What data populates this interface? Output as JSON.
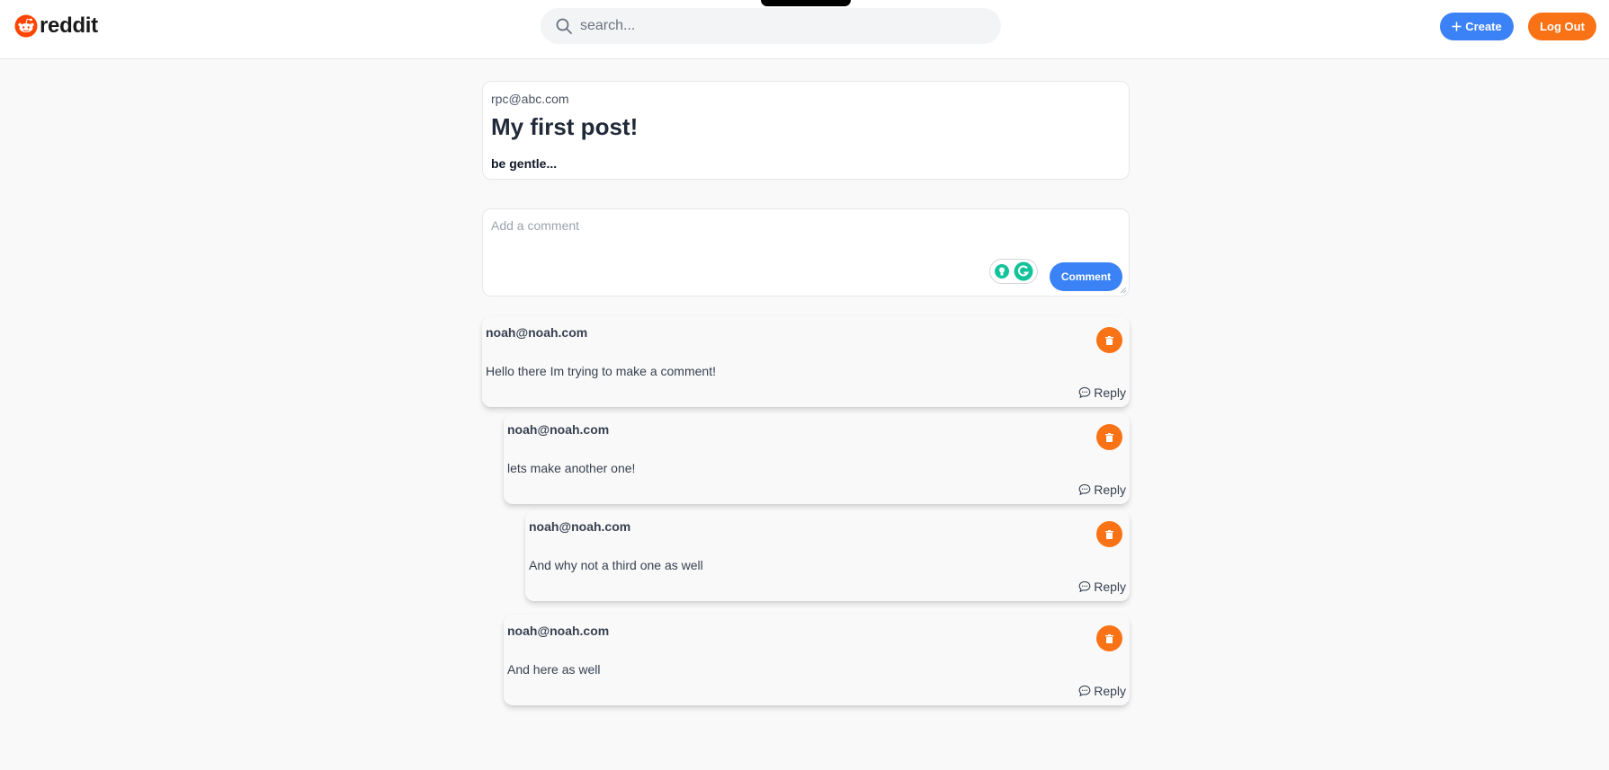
{
  "header": {
    "logo_text": "reddit",
    "search_placeholder": "search...",
    "create_label": "Create",
    "logout_label": "Log Out"
  },
  "post": {
    "author": "rpc@abc.com",
    "title": "My first post!",
    "body": "be gentle..."
  },
  "comment_form": {
    "placeholder": "Add a comment",
    "submit_label": "Comment"
  },
  "comments": [
    {
      "author": "noah@noah.com",
      "text": "Hello there Im trying to make a comment!",
      "reply_label": "Reply"
    },
    {
      "author": "noah@noah.com",
      "text": "lets make another one!",
      "reply_label": "Reply"
    },
    {
      "author": "noah@noah.com",
      "text": "And why not a third one as well",
      "reply_label": "Reply"
    },
    {
      "author": "noah@noah.com",
      "text": "And here as well",
      "reply_label": "Reply"
    }
  ],
  "colors": {
    "primary": "#3b82f6",
    "accent": "#f97316",
    "reddit_red": "#ff4500",
    "background": "#f9f9f9"
  },
  "icons": [
    "reddit-logo-icon",
    "search-icon",
    "plus-icon",
    "grammarly-icon",
    "trash-icon",
    "chat-bubble-icon"
  ]
}
